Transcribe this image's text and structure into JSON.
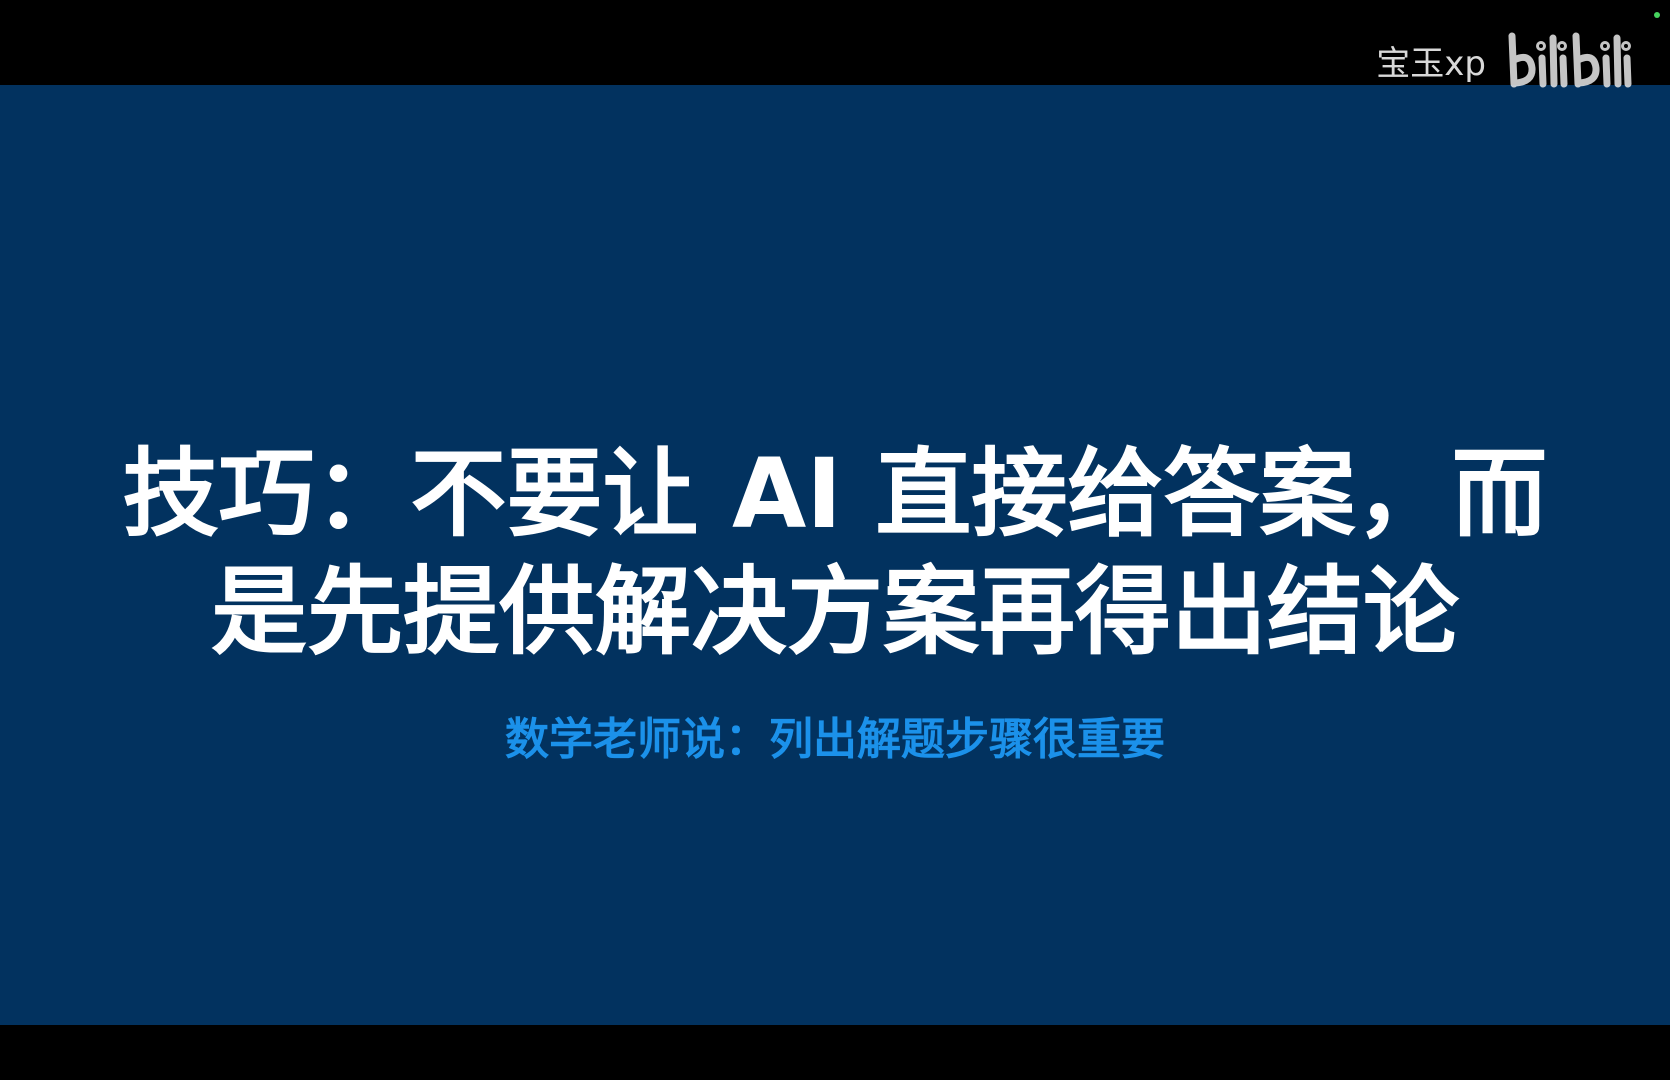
{
  "watermark": {
    "uploader": "宝玉xp",
    "logo_icon": "bilibili-logo-icon",
    "logo_text": "bilibili"
  },
  "slide": {
    "title_line1": "技巧：不要让 AI 直接给答案，而",
    "title_line2": "是先提供解决方案再得出结论",
    "subtitle": "数学老师说：列出解题步骤很重要"
  },
  "colors": {
    "slide_background": "#02325f",
    "title_text": "#ffffff",
    "subtitle_text": "#1b91ea",
    "letterbox": "#000000"
  }
}
